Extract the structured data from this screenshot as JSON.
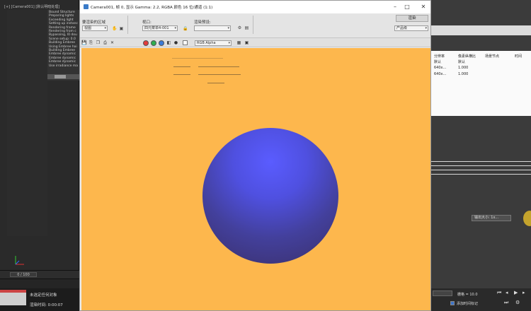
{
  "background": {
    "viewport_label": "[+] [Camera001] [默认明暗处理]",
    "vray_title": "V-Ray m",
    "vray_log": [
      "Bound Structure",
      "Preparing lights",
      "Exceeding light",
      "Setting up instanc",
      "Rendering frame",
      "Rendering from c",
      "Bypassing, l0 dou",
      "Scene setup: 0.0",
      "Building Embree",
      "Using Embree hai",
      "Building Embree",
      "Embree dynamic",
      "Embree dynamic",
      "Embree dynamic",
      "Use irradiance ma"
    ],
    "timeline_value": "0 / 100",
    "status_line1": "未选定任何对象",
    "status_line2": "渲染时间: 0:00:07"
  },
  "frame_buffer": {
    "window_title": "Camera001, 帧 0, 显示 Gamma: 2.2, RGBA 颜色 16 位/通道 (1:1)",
    "toolbar": {
      "area_label": "要渲染的区域",
      "area_value": "视图",
      "viewport_label": "视口:",
      "viewport_value": "四元菜单4-001",
      "preset_label": "渲染预设:",
      "preset_value": "",
      "save_label": "渲染",
      "output_value": "产品级"
    },
    "channel_value": "RGB Alpha",
    "colors": {
      "canvas": "#fdb74d",
      "sphere_top": "#5a5cff",
      "sphere_bottom": "#3a2f6a"
    }
  },
  "right_panel": {
    "columns": [
      "分辨率",
      "像素纵横比",
      "场景节点",
      "时间"
    ],
    "rows": [
      [
        "默认",
        "默认",
        "",
        ""
      ],
      [
        "640x...",
        "1.000",
        "",
        ""
      ],
      [
        "640x...",
        "1.000",
        "",
        ""
      ]
    ],
    "field_value": "输出大小: 1x...",
    "bottom_text1": "栅格 = 10.0",
    "bottom_text2": "添加时间标记"
  }
}
